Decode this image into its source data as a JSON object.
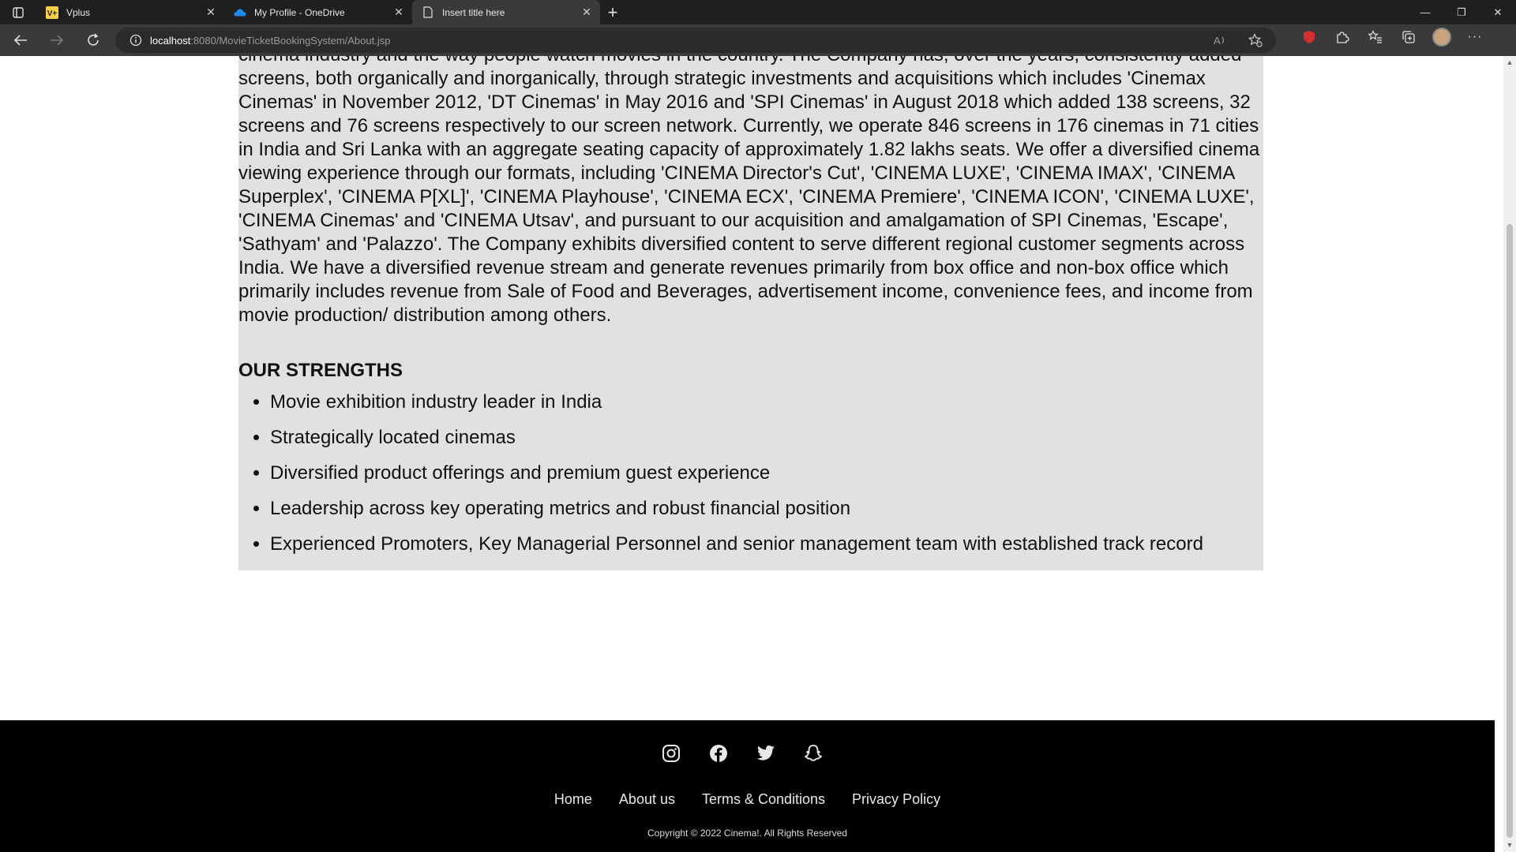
{
  "browser": {
    "tabs": [
      {
        "title": "Vplus",
        "icon": "vplus-icon"
      },
      {
        "title": "My Profile - OneDrive",
        "icon": "onedrive-icon"
      },
      {
        "title": "Insert title here",
        "icon": "page-icon",
        "active": true
      }
    ],
    "url_host": "localhost",
    "url_path": ":8080/MovieTicketBookingSystem/About.jsp"
  },
  "about": {
    "text": "cinema industry and the way people watch movies in the country. The Company has, over the years, consistently added screens, both organically and inorganically, through strategic investments and acquisitions which includes 'Cinemax Cinemas' in November 2012, 'DT Cinemas' in May 2016 and 'SPI Cinemas' in August 2018 which added 138 screens, 32 screens and 76 screens respectively to our screen network. Currently, we operate 846 screens in 176 cinemas in 71 cities in India and Sri Lanka with an aggregate seating capacity of approximately 1.82 lakhs seats. We offer a diversified cinema viewing experience through our formats, including 'CINEMA Director's Cut', 'CINEMA LUXE', 'CINEMA IMAX', 'CINEMA Superplex', 'CINEMA P[XL]', 'CINEMA Playhouse', 'CINEMA ECX', 'CINEMA Premiere', 'CINEMA ICON', 'CINEMA LUXE', 'CINEMA Cinemas' and 'CINEMA Utsav', and pursuant to our acquisition and amalgamation of SPI Cinemas, 'Escape', 'Sathyam' and 'Palazzo'. The Company exhibits diversified content to serve different regional customer segments across India. We have a diversified revenue stream and generate revenues primarily from box office and non-box office which primarily includes revenue from Sale of Food and Beverages, advertisement income, convenience fees, and income from movie production/ distribution among others."
  },
  "strengths": {
    "title": "OUR STRENGTHS",
    "items": [
      "Movie exhibition industry leader in India",
      "Strategically located cinemas",
      "Diversified product offerings and premium guest experience",
      "Leadership across key operating metrics and robust financial position",
      "Experienced Promoters, Key Managerial Personnel and senior management team with established track record"
    ]
  },
  "footer": {
    "social": [
      "instagram-icon",
      "facebook-icon",
      "twitter-icon",
      "snapchat-icon"
    ],
    "links": [
      "Home",
      "About us",
      "Terms & Conditions",
      "Privacy Policy"
    ],
    "copyright": "Copyright © 2022 Cinema!. All Rights Reserved"
  }
}
